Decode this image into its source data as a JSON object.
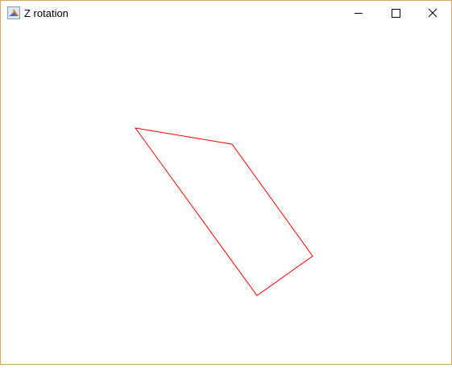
{
  "window": {
    "title": "Z rotation",
    "border_color": "#e3a35a",
    "controls": [
      {
        "name": "minimize",
        "icon": "minimize-icon"
      },
      {
        "name": "maximize",
        "icon": "maximize-icon"
      },
      {
        "name": "close",
        "icon": "close-icon"
      }
    ]
  },
  "figure": {
    "shape": "quadrilateral outline",
    "stroke_color": "#ff0000",
    "background": "#ffffff"
  }
}
